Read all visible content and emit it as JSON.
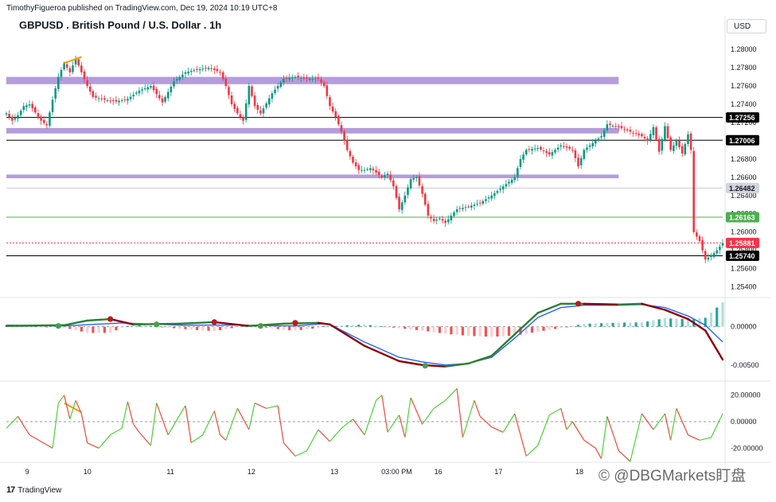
{
  "header": {
    "credit": "TimothyFigueroa published on TradingView.com, Dec 19, 2024 10:19 UTC+8",
    "symbol_title": "GBPUSD . British Pound / U.S. Dollar . 1h",
    "currency_button": "USD"
  },
  "footer": {
    "brand_logo": "17",
    "brand_name": "TradingView",
    "watermark": "© @DBGMarkets盯盘"
  },
  "colors": {
    "up": "#089981",
    "down": "#f23645",
    "zone": "#b39ddb",
    "macd_fast": "#2962ff",
    "signal_up": "#2e7d32",
    "signal_down": "#8b0000",
    "osc_up": "#4cd137",
    "osc_down": "#e74c3c",
    "orange": "#ff9800",
    "grid": "#f0f3fa"
  },
  "chart_data": [
    {
      "type": "candlestick",
      "title": "GBPUSD . British Pound / U.S. Dollar . 1h",
      "ylim": [
        1.253,
        1.2815
      ],
      "y_ticks": [
        "1.28000",
        "1.27800",
        "1.27600",
        "1.27400",
        "1.27200",
        "1.27000",
        "1.26800",
        "1.26600",
        "1.26400",
        "1.26200",
        "1.26000",
        "1.25800",
        "1.25600",
        "1.25400"
      ],
      "x_tick_labels": [
        "9",
        "10",
        "11",
        "12",
        "13",
        "03:00 PM",
        "16",
        "17",
        "18"
      ],
      "price_tags": [
        {
          "label": "1.27256",
          "value": 1.27256,
          "style": "black"
        },
        {
          "label": "1.27006",
          "value": 1.27006,
          "style": "black"
        },
        {
          "label": "1.26482",
          "value": 1.26482,
          "style": "grey"
        },
        {
          "label": "1.26163",
          "value": 1.26163,
          "style": "green"
        },
        {
          "label": "1.25881",
          "value": 1.25881,
          "style": "red"
        },
        {
          "label": "1.25740",
          "value": 1.2574,
          "style": "black"
        }
      ],
      "horizontal_lines": [
        {
          "value": 1.27256,
          "color": "#000000"
        },
        {
          "value": 1.27006,
          "color": "#000000"
        },
        {
          "value": 1.26482,
          "color": "#cccccc"
        },
        {
          "value": 1.26163,
          "color": "#4caf50"
        },
        {
          "value": 1.25881,
          "color": "#f23645",
          "dashed": true
        },
        {
          "value": 1.2574,
          "color": "#000000"
        }
      ],
      "zones": [
        {
          "from": 1.2762,
          "to": 1.277,
          "extent": "left to 18-mid"
        },
        {
          "from": 1.2708,
          "to": 1.2714,
          "extent": "left to 18-mid"
        },
        {
          "from": 1.2659,
          "to": 1.2663,
          "extent": "left to 18-mid"
        }
      ],
      "close_path": [
        [
          0,
          1.273
        ],
        [
          2,
          1.2722
        ],
        [
          4,
          1.2728
        ],
        [
          6,
          1.2738
        ],
        [
          8,
          1.274
        ],
        [
          10,
          1.2731
        ],
        [
          12,
          1.2722
        ],
        [
          14,
          1.2717
        ],
        [
          16,
          1.2745
        ],
        [
          18,
          1.277
        ],
        [
          20,
          1.2785
        ],
        [
          22,
          1.2775
        ],
        [
          24,
          1.279
        ],
        [
          26,
          1.2775
        ],
        [
          28,
          1.276
        ],
        [
          30,
          1.2748
        ],
        [
          34,
          1.2745
        ],
        [
          38,
          1.2743
        ],
        [
          42,
          1.2746
        ],
        [
          46,
          1.2755
        ],
        [
          50,
          1.276
        ],
        [
          54,
          1.2742
        ],
        [
          58,
          1.2765
        ],
        [
          62,
          1.2775
        ],
        [
          66,
          1.2778
        ],
        [
          70,
          1.278
        ],
        [
          74,
          1.2775
        ],
        [
          76,
          1.276
        ],
        [
          78,
          1.274
        ],
        [
          80,
          1.273
        ],
        [
          82,
          1.2722
        ],
        [
          84,
          1.276
        ],
        [
          86,
          1.2738
        ],
        [
          88,
          1.273
        ],
        [
          92,
          1.2752
        ],
        [
          96,
          1.2768
        ],
        [
          100,
          1.277
        ],
        [
          104,
          1.2768
        ],
        [
          108,
          1.2768
        ],
        [
          110,
          1.276
        ],
        [
          112,
          1.2738
        ],
        [
          114,
          1.2726
        ],
        [
          116,
          1.271
        ],
        [
          118,
          1.269
        ],
        [
          120,
          1.2676
        ],
        [
          122,
          1.2668
        ],
        [
          124,
          1.2668
        ],
        [
          126,
          1.267
        ],
        [
          128,
          1.2665
        ],
        [
          130,
          1.266
        ],
        [
          132,
          1.2664
        ],
        [
          134,
          1.265
        ],
        [
          136,
          1.2625
        ],
        [
          138,
          1.264
        ],
        [
          140,
          1.2658
        ],
        [
          142,
          1.266
        ],
        [
          144,
          1.2642
        ],
        [
          146,
          1.2618
        ],
        [
          148,
          1.2612
        ],
        [
          150,
          1.2615
        ],
        [
          152,
          1.261
        ],
        [
          154,
          1.2618
        ],
        [
          156,
          1.2625
        ],
        [
          160,
          1.2628
        ],
        [
          164,
          1.2632
        ],
        [
          168,
          1.264
        ],
        [
          172,
          1.265
        ],
        [
          176,
          1.266
        ],
        [
          178,
          1.268
        ],
        [
          180,
          1.269
        ],
        [
          184,
          1.2692
        ],
        [
          188,
          1.2685
        ],
        [
          192,
          1.2695
        ],
        [
          196,
          1.269
        ],
        [
          198,
          1.2672
        ],
        [
          200,
          1.269
        ],
        [
          204,
          1.27
        ],
        [
          206,
          1.2705
        ],
        [
          208,
          1.2718
        ],
        [
          212,
          1.2715
        ],
        [
          216,
          1.271
        ],
        [
          220,
          1.2705
        ],
        [
          222,
          1.27
        ],
        [
          224,
          1.2715
        ],
        [
          226,
          1.2688
        ],
        [
          228,
          1.2716
        ],
        [
          230,
          1.269
        ],
        [
          232,
          1.27
        ],
        [
          234,
          1.2686
        ],
        [
          236,
          1.2707
        ],
        [
          237,
          1.269
        ],
        [
          238,
          1.26
        ],
        [
          240,
          1.259
        ],
        [
          242,
          1.257
        ],
        [
          244,
          1.2574
        ],
        [
          246,
          1.258
        ],
        [
          248,
          1.2588
        ]
      ]
    },
    {
      "type": "line",
      "name": "macd",
      "ylim": [
        -0.007,
        0.0035
      ],
      "y_ticks": [
        "0.00000",
        "-0.00500"
      ],
      "macd": [
        [
          0,
          0.0002
        ],
        [
          20,
          0.0001
        ],
        [
          40,
          0.0005
        ],
        [
          60,
          0.0002
        ],
        [
          80,
          0.0002
        ],
        [
          100,
          0.0001
        ],
        [
          110,
          0.0004
        ],
        [
          112,
          0.0003
        ],
        [
          124,
          -0.002
        ],
        [
          136,
          -0.004
        ],
        [
          144,
          -0.0046
        ],
        [
          152,
          -0.005
        ],
        [
          160,
          -0.0048
        ],
        [
          168,
          -0.004
        ],
        [
          176,
          -0.0015
        ],
        [
          184,
          0.0012
        ],
        [
          192,
          0.0025
        ],
        [
          200,
          0.0028
        ],
        [
          212,
          0.0028
        ],
        [
          220,
          0.0029
        ],
        [
          228,
          0.0025
        ],
        [
          236,
          0.0014
        ],
        [
          242,
          0.0002
        ],
        [
          248,
          -0.002
        ]
      ],
      "signal": [
        [
          0,
          0.0001
        ],
        [
          20,
          0.0002
        ],
        [
          28,
          0.0008
        ],
        [
          36,
          0.001
        ],
        [
          44,
          0.0003
        ],
        [
          60,
          0.0004
        ],
        [
          72,
          0.0006
        ],
        [
          84,
          0.0001
        ],
        [
          96,
          0.0004
        ],
        [
          108,
          0.0005
        ],
        [
          112,
          0.0003
        ],
        [
          124,
          -0.0025
        ],
        [
          136,
          -0.0045
        ],
        [
          144,
          -0.005
        ],
        [
          152,
          -0.0052
        ],
        [
          160,
          -0.0048
        ],
        [
          168,
          -0.0038
        ],
        [
          176,
          -0.001
        ],
        [
          184,
          0.0018
        ],
        [
          192,
          0.003
        ],
        [
          200,
          0.003
        ],
        [
          212,
          0.0029
        ],
        [
          220,
          0.003
        ],
        [
          228,
          0.0022
        ],
        [
          236,
          0.001
        ],
        [
          242,
          -0.0005
        ],
        [
          248,
          -0.0043
        ]
      ],
      "cross_markers": [
        [
          18,
          0.0001,
          "up"
        ],
        [
          36,
          0.001,
          "down"
        ],
        [
          52,
          0.0003,
          "up"
        ],
        [
          72,
          0.0006,
          "down"
        ],
        [
          88,
          0.0001,
          "up"
        ],
        [
          100,
          0.0005,
          "down"
        ],
        [
          145,
          -0.0051,
          "up"
        ],
        [
          198,
          0.003,
          "down"
        ]
      ]
    },
    {
      "type": "line",
      "name": "oscillator",
      "ylim": [
        -30,
        30
      ],
      "y_ticks": [
        "20.00000",
        "0.00000",
        "-20.00000"
      ],
      "values": [
        [
          0,
          -5
        ],
        [
          4,
          4
        ],
        [
          8,
          -10
        ],
        [
          12,
          -15
        ],
        [
          16,
          -20
        ],
        [
          18,
          14
        ],
        [
          20,
          20
        ],
        [
          22,
          2
        ],
        [
          24,
          16
        ],
        [
          26,
          6
        ],
        [
          28,
          -16
        ],
        [
          32,
          -20
        ],
        [
          36,
          -10
        ],
        [
          40,
          -5
        ],
        [
          42,
          15
        ],
        [
          44,
          -2
        ],
        [
          46,
          -8
        ],
        [
          50,
          -18
        ],
        [
          52,
          14
        ],
        [
          56,
          -10
        ],
        [
          60,
          5
        ],
        [
          62,
          12
        ],
        [
          64,
          -16
        ],
        [
          68,
          -10
        ],
        [
          72,
          8
        ],
        [
          74,
          -10
        ],
        [
          76,
          -14
        ],
        [
          80,
          10
        ],
        [
          84,
          -6
        ],
        [
          86,
          14
        ],
        [
          90,
          10
        ],
        [
          94,
          12
        ],
        [
          96,
          -16
        ],
        [
          100,
          -26
        ],
        [
          104,
          -22
        ],
        [
          108,
          -6
        ],
        [
          112,
          -15
        ],
        [
          116,
          -5
        ],
        [
          120,
          2
        ],
        [
          124,
          -10
        ],
        [
          128,
          16
        ],
        [
          130,
          20
        ],
        [
          132,
          -8
        ],
        [
          136,
          5
        ],
        [
          138,
          -12
        ],
        [
          140,
          18
        ],
        [
          144,
          -2
        ],
        [
          148,
          10
        ],
        [
          152,
          16
        ],
        [
          156,
          25
        ],
        [
          158,
          -12
        ],
        [
          162,
          16
        ],
        [
          164,
          4
        ],
        [
          168,
          -4
        ],
        [
          172,
          -8
        ],
        [
          176,
          6
        ],
        [
          180,
          -26
        ],
        [
          184,
          -18
        ],
        [
          188,
          5
        ],
        [
          192,
          10
        ],
        [
          194,
          -6
        ],
        [
          196,
          0
        ],
        [
          200,
          -14
        ],
        [
          204,
          -20
        ],
        [
          206,
          -28
        ],
        [
          208,
          4
        ],
        [
          212,
          -22
        ],
        [
          216,
          -30
        ],
        [
          220,
          6
        ],
        [
          224,
          -6
        ],
        [
          228,
          6
        ],
        [
          230,
          -14
        ],
        [
          232,
          10
        ],
        [
          236,
          -10
        ],
        [
          240,
          -14
        ],
        [
          244,
          -12
        ],
        [
          248,
          6
        ]
      ]
    }
  ]
}
